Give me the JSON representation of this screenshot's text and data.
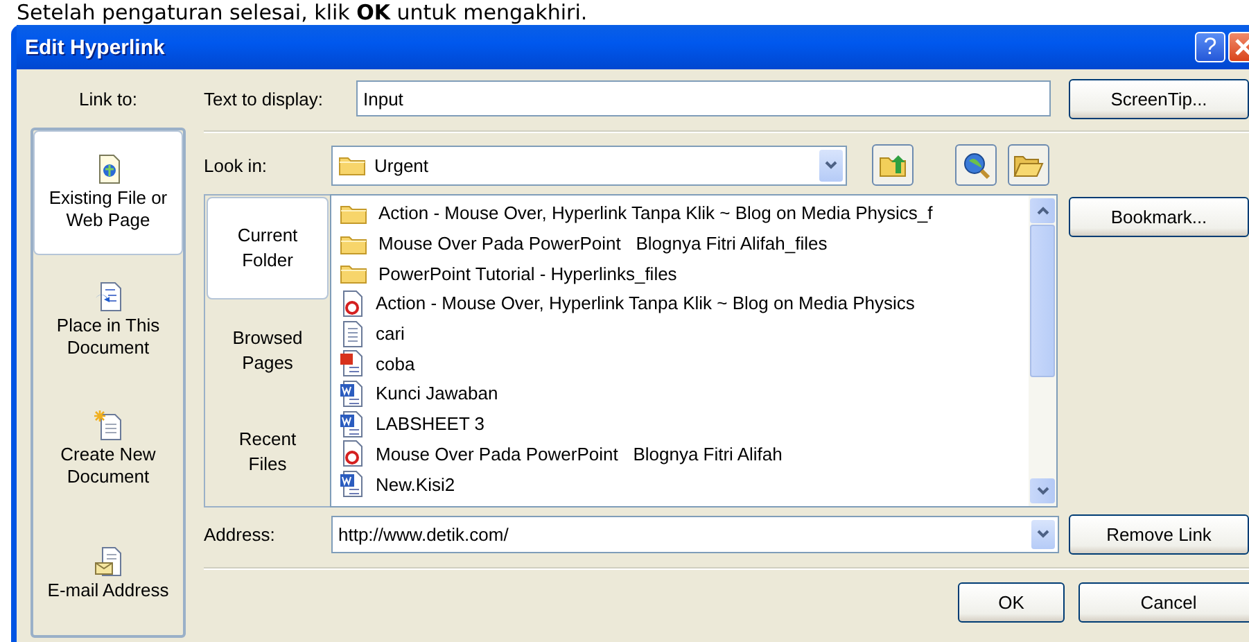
{
  "caption": "Setelah pengaturan selesai, klik **OK** untuk mengakhiri.",
  "window": {
    "title": "Edit Hyperlink",
    "help": "?"
  },
  "link_to": {
    "label": "Link to:",
    "items": [
      {
        "kind": "existing",
        "label": "Existing File or Web Page",
        "selected": true
      },
      {
        "kind": "place",
        "label": "Place in This Document",
        "selected": false
      },
      {
        "kind": "new",
        "label": "Create New Document",
        "selected": false
      },
      {
        "kind": "email",
        "label": "E-mail Address",
        "selected": false
      }
    ]
  },
  "text_to_display": {
    "label": "Text to display:",
    "value": "Input"
  },
  "screentip_button": "ScreenTip...",
  "look_in": {
    "label": "Look in:",
    "value": "Urgent"
  },
  "browse_tabs": [
    {
      "label": "Current Folder",
      "selected": true
    },
    {
      "label": "Browsed Pages",
      "selected": false
    },
    {
      "label": "Recent Files",
      "selected": false
    }
  ],
  "files": [
    {
      "kind": "folder",
      "name": "Action - Mouse Over, Hyperlink Tanpa Klik ~ Blog on Media Physics_f"
    },
    {
      "kind": "folder",
      "name": "Mouse Over Pada PowerPoint   Blognya Fitri Alifah_files"
    },
    {
      "kind": "folder",
      "name": "PowerPoint Tutorial - Hyperlinks_files"
    },
    {
      "kind": "web",
      "name": "Action - Mouse Over, Hyperlink Tanpa Klik ~ Blog on Media Physics"
    },
    {
      "kind": "text",
      "name": "cari"
    },
    {
      "kind": "slides",
      "name": "coba"
    },
    {
      "kind": "word",
      "name": "Kunci Jawaban"
    },
    {
      "kind": "word",
      "name": "LABSHEET 3"
    },
    {
      "kind": "web",
      "name": "Mouse Over Pada PowerPoint   Blognya Fitri Alifah"
    },
    {
      "kind": "word",
      "name": "New.Kisi2"
    }
  ],
  "bookmark_button": "Bookmark...",
  "address": {
    "label": "Address:",
    "value": "http://www.detik.com/"
  },
  "remove_link_button": "Remove Link",
  "buttons": [
    "OK",
    "Cancel"
  ]
}
